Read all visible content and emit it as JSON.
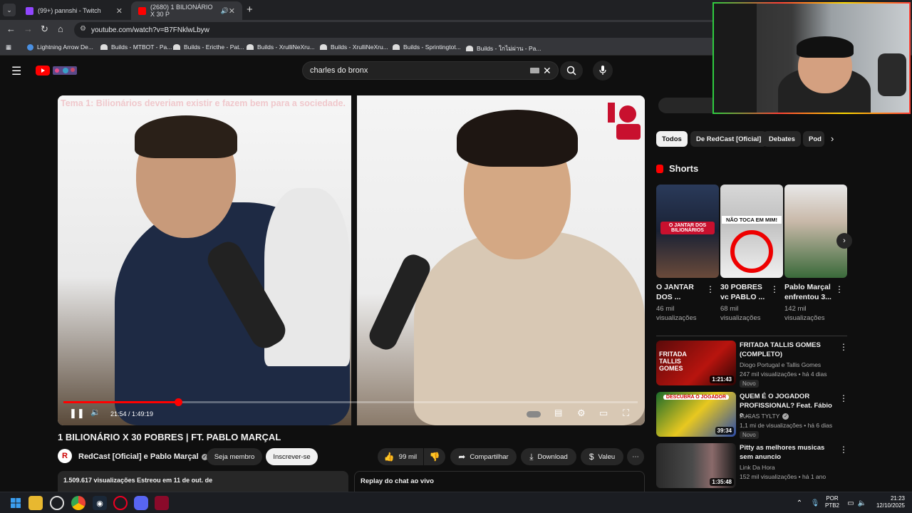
{
  "browser": {
    "tabs": [
      {
        "title": "(99+) pannshi - Twitch",
        "close": "✕",
        "active": false
      },
      {
        "title": "(2680) 1 BILIONÁRIO X 30 P",
        "close": "✕",
        "active": true
      }
    ],
    "new_tab": "+",
    "url": "youtube.com/watch?v=B7FNklwLbyw",
    "bookmarks": [
      "Lightning Arrow De...",
      "Builds - MTBOT - Pa...",
      "Builds - Ericthe - Pat...",
      "Builds - XrulliNeXru...",
      "Builds - XrulliNeXru...",
      "Builds - Sprintingtot...",
      "Builds - ใกไม่ผ่าน - Pa..."
    ]
  },
  "header": {
    "search_value": "charles do bronx"
  },
  "player": {
    "overlay_text": "Tema 1: Bilionários deveriam existir e fazem bem para a sociedade.",
    "time": "21:54 / 1:49:19",
    "progress": 0.2
  },
  "video": {
    "title": "1 BILIONÁRIO X 30 POBRES | FT. PABLO MARÇAL",
    "channel_initial": "R",
    "channel": "RedCast [Oficial] e Pablo Marçal",
    "verified": "✓",
    "member_btn": "Seja membro",
    "subscribe_btn": "Inscrever-se",
    "likes": "99 mil",
    "share": "Compartilhar",
    "download": "Download",
    "thanks": "Valeu",
    "description": "1.509.617 visualizações  Estreou em 11 de out. de",
    "chat_replay": "Replay do chat ao vivo"
  },
  "chips": [
    {
      "label": "Todos",
      "active": true
    },
    {
      "label": "De RedCast [Oficial]",
      "active": false
    },
    {
      "label": "Debates",
      "active": false
    },
    {
      "label": "Pod",
      "active": false
    }
  ],
  "shorts": {
    "heading": "Shorts",
    "items": [
      {
        "title": "O JANTAR DOS ...",
        "views": "46 mil visualizações",
        "thumb_text": "O JANTAR DOS BILIONÁRIOS"
      },
      {
        "title": "30 POBRES vc PABLO ...",
        "views": "68 mil visualizações",
        "thumb_text": "NÃO TOCA EM MIM!"
      },
      {
        "title": "Pablo Marçal enfrentou 3...",
        "views": "142 mil visualizações",
        "thumb_text": ""
      }
    ]
  },
  "recommendations": [
    {
      "title": "FRITADA TALLIS GOMES (COMPLETO)",
      "channel": "Diogo Portugal e Tallis Gomes",
      "meta": "247 mil visualizações • há 4 dias",
      "badge": "Novo",
      "duration": "1:21:43",
      "thumb_text": "FRITADA TALLIS GOMES"
    },
    {
      "title": "QUEM É O JOGADOR PROFISSIONAL? Feat. Fábio e ...",
      "channel": "LUCAS TYLTY",
      "meta": "1,1 mi de visualizações • há 6 dias",
      "badge": "Novo",
      "duration": "39:34",
      "thumb_text": "DESCUBRA O JOGADOR"
    },
    {
      "title": "Pitty as melhores musicas sem anuncio",
      "channel": "Link Da Hora",
      "meta": "152 mil visualizações • há 1 ano",
      "badge": "",
      "duration": "1:35:48",
      "thumb_text": ""
    }
  ],
  "taskbar": {
    "lang1": "POR",
    "lang2": "PTB2",
    "time": "21:23",
    "date": "12/10/2025"
  }
}
